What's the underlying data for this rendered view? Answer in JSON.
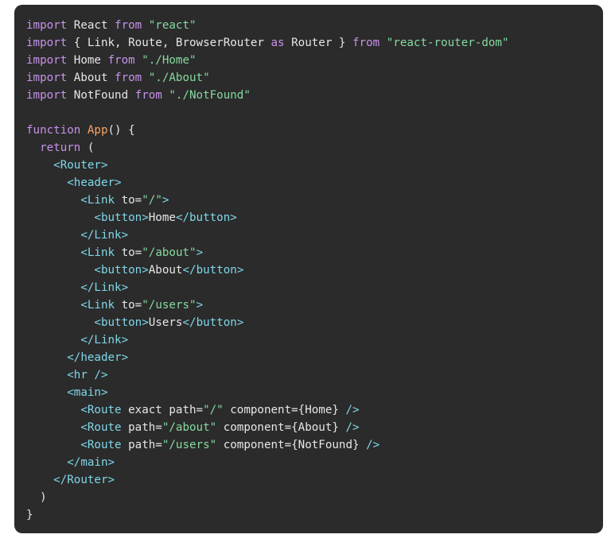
{
  "code": {
    "lines": [
      [
        {
          "t": "kw",
          "v": "import"
        },
        {
          "t": "plain",
          "v": " React "
        },
        {
          "t": "kw",
          "v": "from"
        },
        {
          "t": "plain",
          "v": " "
        },
        {
          "t": "str",
          "v": "\"react\""
        }
      ],
      [
        {
          "t": "kw",
          "v": "import"
        },
        {
          "t": "plain",
          "v": " { Link, Route, BrowserRouter "
        },
        {
          "t": "kw",
          "v": "as"
        },
        {
          "t": "plain",
          "v": " Router } "
        },
        {
          "t": "kw",
          "v": "from"
        },
        {
          "t": "plain",
          "v": " "
        },
        {
          "t": "str",
          "v": "\"react-router-dom\""
        }
      ],
      [
        {
          "t": "kw",
          "v": "import"
        },
        {
          "t": "plain",
          "v": " Home "
        },
        {
          "t": "kw",
          "v": "from"
        },
        {
          "t": "plain",
          "v": " "
        },
        {
          "t": "str",
          "v": "\"./Home\""
        }
      ],
      [
        {
          "t": "kw",
          "v": "import"
        },
        {
          "t": "plain",
          "v": " About "
        },
        {
          "t": "kw",
          "v": "from"
        },
        {
          "t": "plain",
          "v": " "
        },
        {
          "t": "str",
          "v": "\"./About\""
        }
      ],
      [
        {
          "t": "kw",
          "v": "import"
        },
        {
          "t": "plain",
          "v": " NotFound "
        },
        {
          "t": "kw",
          "v": "from"
        },
        {
          "t": "plain",
          "v": " "
        },
        {
          "t": "str",
          "v": "\"./NotFound\""
        }
      ],
      [],
      [
        {
          "t": "kw",
          "v": "function"
        },
        {
          "t": "plain",
          "v": " "
        },
        {
          "t": "fn",
          "v": "App"
        },
        {
          "t": "plain",
          "v": "() {"
        }
      ],
      [
        {
          "t": "plain",
          "v": "  "
        },
        {
          "t": "kw",
          "v": "return"
        },
        {
          "t": "plain",
          "v": " ("
        }
      ],
      [
        {
          "t": "plain",
          "v": "    "
        },
        {
          "t": "tag",
          "v": "<Router>"
        }
      ],
      [
        {
          "t": "plain",
          "v": "      "
        },
        {
          "t": "tag",
          "v": "<header>"
        }
      ],
      [
        {
          "t": "plain",
          "v": "        "
        },
        {
          "t": "tag",
          "v": "<Link"
        },
        {
          "t": "attr",
          "v": " to="
        },
        {
          "t": "str",
          "v": "\"/\""
        },
        {
          "t": "tag",
          "v": ">"
        }
      ],
      [
        {
          "t": "plain",
          "v": "          "
        },
        {
          "t": "tag",
          "v": "<button>"
        },
        {
          "t": "plain",
          "v": "Home"
        },
        {
          "t": "tag",
          "v": "</button>"
        }
      ],
      [
        {
          "t": "plain",
          "v": "        "
        },
        {
          "t": "tag",
          "v": "</Link>"
        }
      ],
      [
        {
          "t": "plain",
          "v": "        "
        },
        {
          "t": "tag",
          "v": "<Link"
        },
        {
          "t": "attr",
          "v": " to="
        },
        {
          "t": "str",
          "v": "\"/about\""
        },
        {
          "t": "tag",
          "v": ">"
        }
      ],
      [
        {
          "t": "plain",
          "v": "          "
        },
        {
          "t": "tag",
          "v": "<button>"
        },
        {
          "t": "plain",
          "v": "About"
        },
        {
          "t": "tag",
          "v": "</button>"
        }
      ],
      [
        {
          "t": "plain",
          "v": "        "
        },
        {
          "t": "tag",
          "v": "</Link>"
        }
      ],
      [
        {
          "t": "plain",
          "v": "        "
        },
        {
          "t": "tag",
          "v": "<Link"
        },
        {
          "t": "attr",
          "v": " to="
        },
        {
          "t": "str",
          "v": "\"/users\""
        },
        {
          "t": "tag",
          "v": ">"
        }
      ],
      [
        {
          "t": "plain",
          "v": "          "
        },
        {
          "t": "tag",
          "v": "<button>"
        },
        {
          "t": "plain",
          "v": "Users"
        },
        {
          "t": "tag",
          "v": "</button>"
        }
      ],
      [
        {
          "t": "plain",
          "v": "        "
        },
        {
          "t": "tag",
          "v": "</Link>"
        }
      ],
      [
        {
          "t": "plain",
          "v": "      "
        },
        {
          "t": "tag",
          "v": "</header>"
        }
      ],
      [
        {
          "t": "plain",
          "v": "      "
        },
        {
          "t": "tag",
          "v": "<hr />"
        }
      ],
      [
        {
          "t": "plain",
          "v": "      "
        },
        {
          "t": "tag",
          "v": "<main>"
        }
      ],
      [
        {
          "t": "plain",
          "v": "        "
        },
        {
          "t": "tag",
          "v": "<Route"
        },
        {
          "t": "attr",
          "v": " exact path="
        },
        {
          "t": "str",
          "v": "\"/\""
        },
        {
          "t": "attr",
          "v": " component={Home} "
        },
        {
          "t": "tag",
          "v": "/>"
        }
      ],
      [
        {
          "t": "plain",
          "v": "        "
        },
        {
          "t": "tag",
          "v": "<Route"
        },
        {
          "t": "attr",
          "v": " path="
        },
        {
          "t": "str",
          "v": "\"/about\""
        },
        {
          "t": "attr",
          "v": " component={About} "
        },
        {
          "t": "tag",
          "v": "/>"
        }
      ],
      [
        {
          "t": "plain",
          "v": "        "
        },
        {
          "t": "tag",
          "v": "<Route"
        },
        {
          "t": "attr",
          "v": " path="
        },
        {
          "t": "str",
          "v": "\"/users\""
        },
        {
          "t": "attr",
          "v": " component={NotFound} "
        },
        {
          "t": "tag",
          "v": "/>"
        }
      ],
      [
        {
          "t": "plain",
          "v": "      "
        },
        {
          "t": "tag",
          "v": "</main>"
        }
      ],
      [
        {
          "t": "plain",
          "v": "    "
        },
        {
          "t": "tag",
          "v": "</Router>"
        }
      ],
      [
        {
          "t": "plain",
          "v": "  )"
        }
      ],
      [
        {
          "t": "plain",
          "v": "}"
        }
      ]
    ]
  },
  "colors": {
    "background": "#2b2b2b",
    "keyword": "#c792ea",
    "string": "#86d9a0",
    "function": "#f7a463",
    "tag": "#7fd7e9",
    "text": "#e6e6e6"
  }
}
